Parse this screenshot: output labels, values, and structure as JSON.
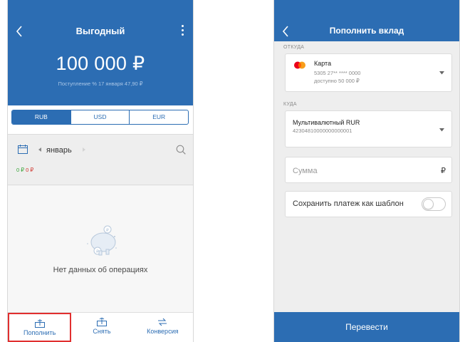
{
  "colors": {
    "primary": "#2c6db3",
    "income": "#3aa43a",
    "expense": "#d0342c",
    "highlight": "#e12f2f"
  },
  "left": {
    "title": "Выгодный",
    "back_icon": "chevron-left-icon",
    "menu_icon": "more-vertical-icon",
    "balance": "100 000 ₽",
    "accrual": "Поступление % 17 января 47,90 ₽",
    "currency_tabs": [
      {
        "label": "RUB",
        "selected": true
      },
      {
        "label": "USD",
        "selected": false
      },
      {
        "label": "EUR",
        "selected": false
      }
    ],
    "filter": {
      "month": "январь",
      "income": "0 ₽",
      "expense": "0 ₽"
    },
    "empty_text": "Нет данных об операциях",
    "bottom_tabs": [
      {
        "label": "Пополнить",
        "icon": "deposit-icon",
        "highlighted": true
      },
      {
        "label": "Снять",
        "icon": "withdraw-icon",
        "highlighted": false
      },
      {
        "label": "Конверсия",
        "icon": "conversion-icon",
        "highlighted": false
      }
    ]
  },
  "right": {
    "title": "Пополнить вклад",
    "from": {
      "label": "ОТКУДА",
      "title": "Карта",
      "number": "5305 27** **** 0000",
      "available": "доступно 50 000 ₽"
    },
    "to": {
      "label": "КУДА",
      "title": "Мультивалютный RUR",
      "number": "42304810000000000001"
    },
    "amount_placeholder": "Сумма",
    "currency_symbol": "₽",
    "template_label": "Сохранить платеж как шаблон",
    "template_enabled": false,
    "submit_label": "Перевести"
  }
}
